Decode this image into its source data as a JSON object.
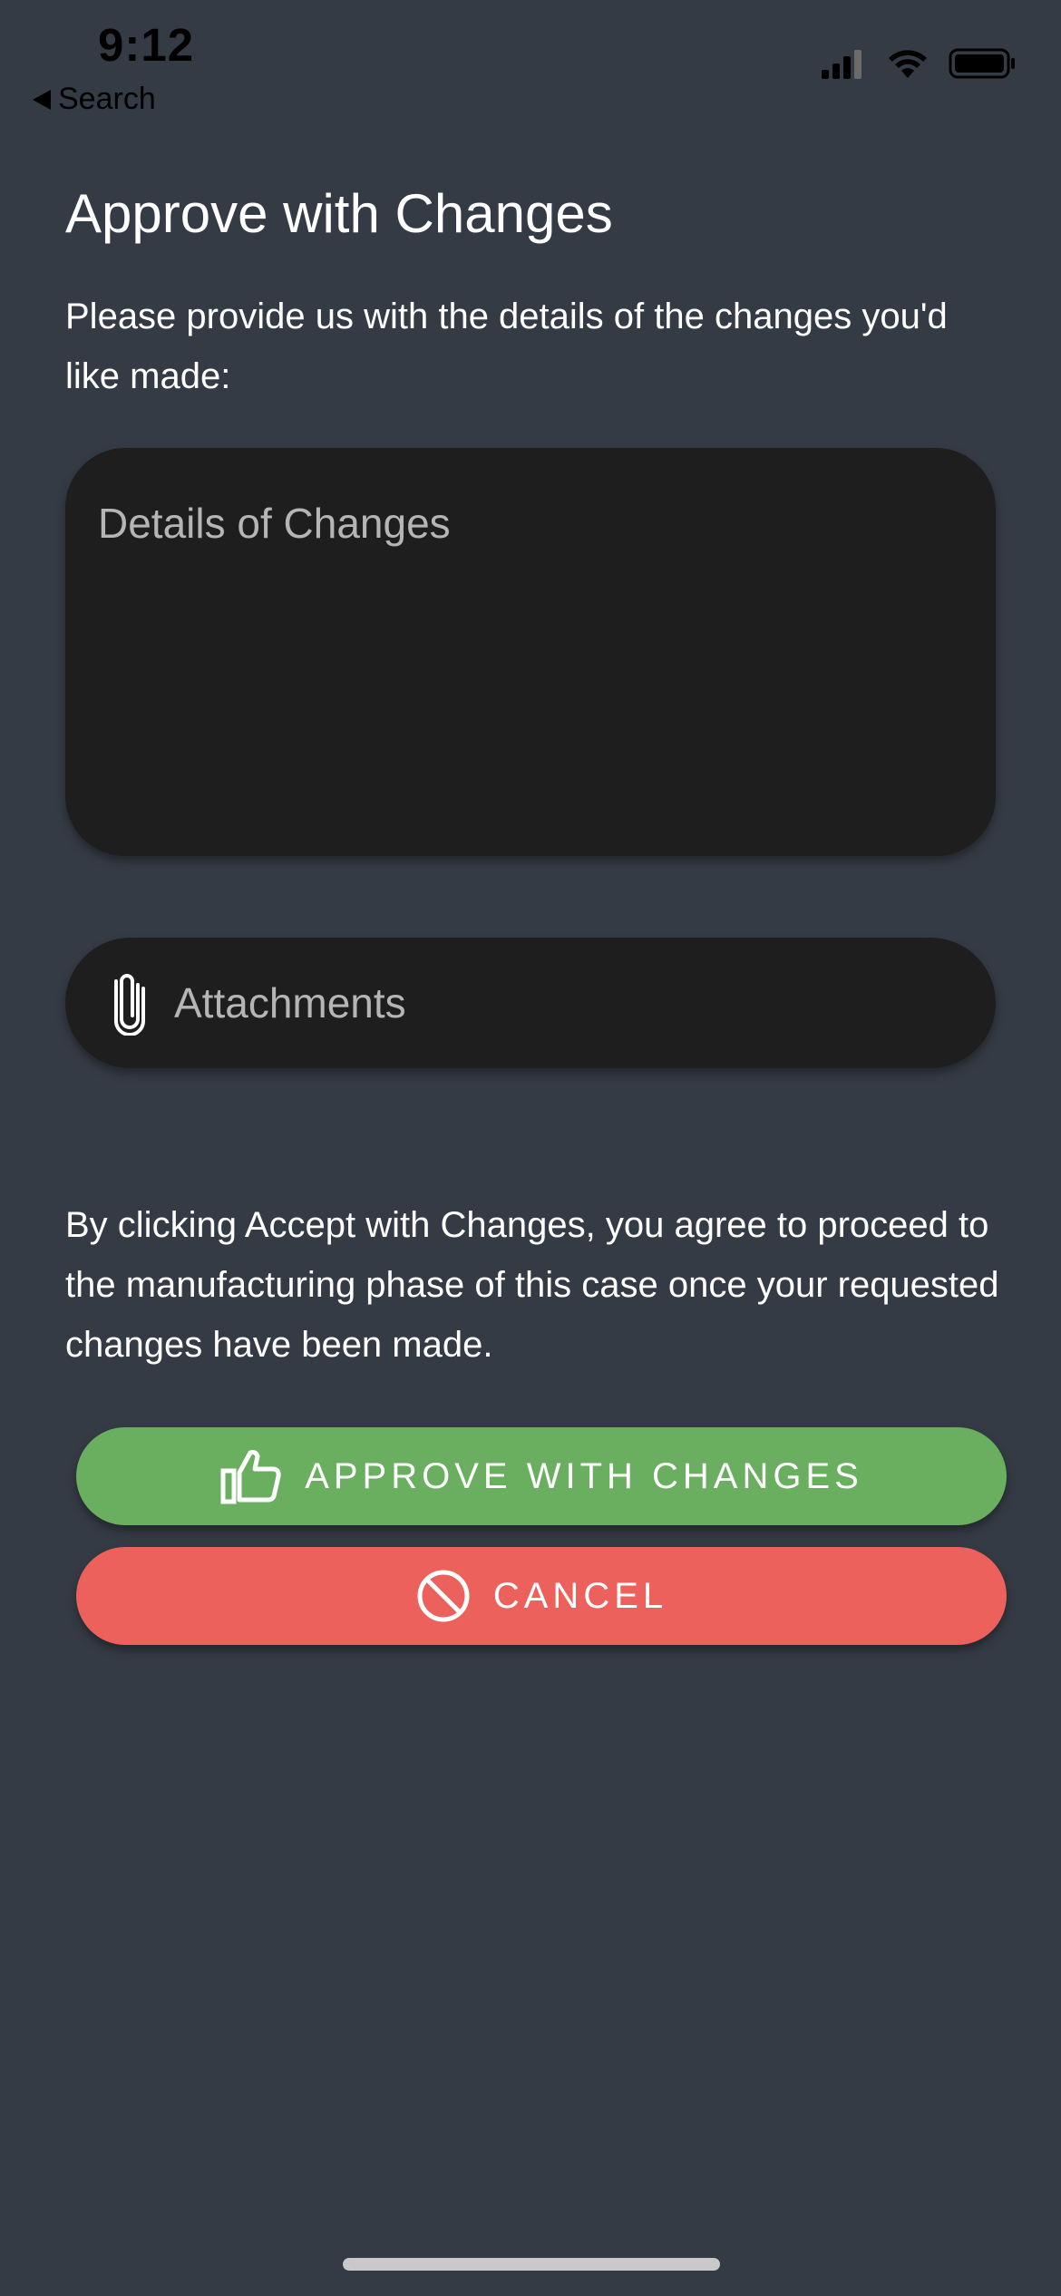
{
  "status_bar": {
    "time": "9:12",
    "back_label": "Search",
    "icons": [
      "signal-icon",
      "wifi-icon",
      "battery-icon"
    ]
  },
  "page": {
    "title": "Approve with Changes",
    "intro": "Please provide us with the details of the changes you'd like made:"
  },
  "details": {
    "placeholder": "Details of Changes",
    "value": ""
  },
  "attachments": {
    "label": "Attachments",
    "icon": "paperclip-icon"
  },
  "agreement": {
    "text": "By clicking Accept with Changes, you agree to proceed to the manufacturing phase of this case once your requested changes have been made."
  },
  "buttons": {
    "approve": {
      "label": "APPROVE WITH CHANGES",
      "icon": "thumbs-up-icon",
      "color": "#6aae5f"
    },
    "cancel": {
      "label": "CANCEL",
      "icon": "prohibited-icon",
      "color": "#ec615b"
    }
  },
  "colors": {
    "background": "#353b45",
    "field": "#1e1e1e",
    "placeholder": "#b5b5b5"
  }
}
